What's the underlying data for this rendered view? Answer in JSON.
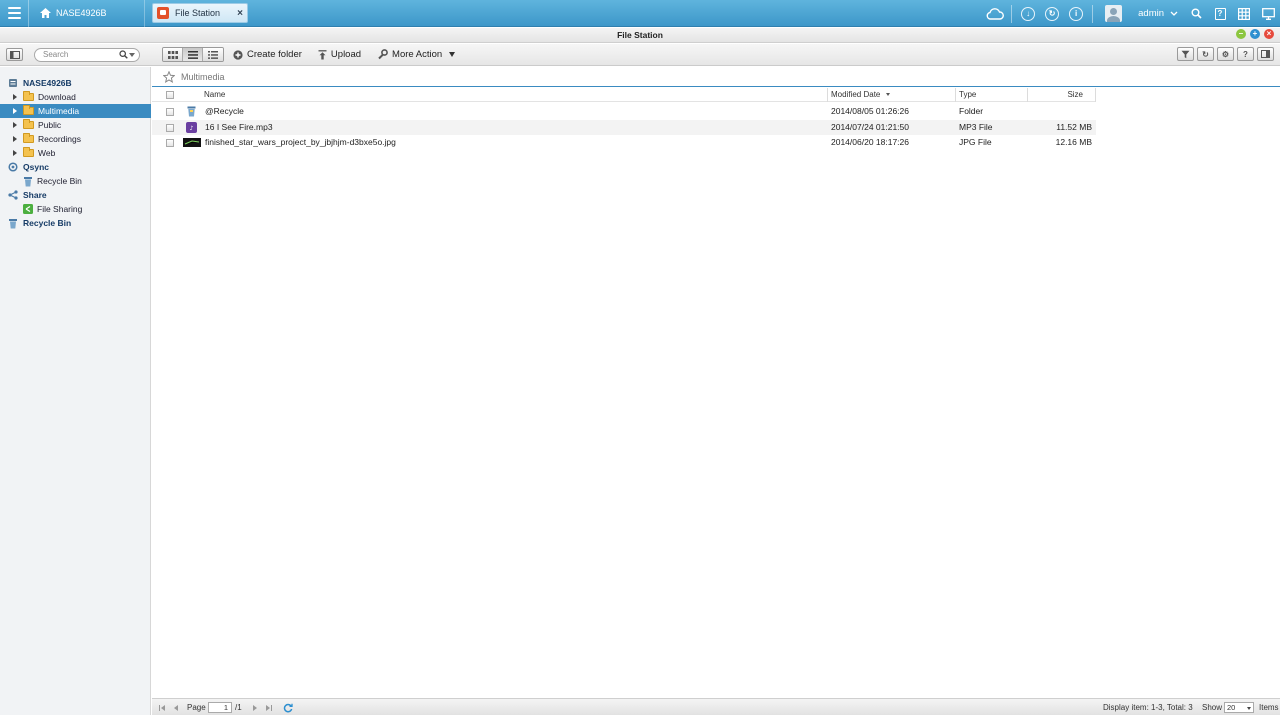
{
  "topbar": {
    "home_label": "NASE4926B",
    "app_tab_label": "File Station",
    "user": "admin"
  },
  "window": {
    "title": "File Station"
  },
  "toolbar": {
    "search_placeholder": "Search",
    "create_folder": "Create folder",
    "upload": "Upload",
    "more_action": "More Action"
  },
  "sidebar": {
    "items": [
      {
        "label": "NASE4926B",
        "kind": "root"
      },
      {
        "label": "Download",
        "kind": "folder"
      },
      {
        "label": "Multimedia",
        "kind": "folder",
        "selected": true
      },
      {
        "label": "Public",
        "kind": "folder"
      },
      {
        "label": "Recordings",
        "kind": "folder"
      },
      {
        "label": "Web",
        "kind": "folder"
      },
      {
        "label": "Qsync",
        "kind": "root"
      },
      {
        "label": "Recycle Bin",
        "kind": "leaf"
      },
      {
        "label": "Share",
        "kind": "root"
      },
      {
        "label": "File Sharing",
        "kind": "leaf"
      },
      {
        "label": "Recycle Bin",
        "kind": "root"
      }
    ]
  },
  "path": {
    "current": "Multimedia"
  },
  "table": {
    "columns": {
      "name": "Name",
      "modified": "Modified Date",
      "type": "Type",
      "size": "Size"
    },
    "rows": [
      {
        "name": "@Recycle",
        "modified": "2014/08/05 01:26:26",
        "type": "Folder",
        "size": "",
        "icon": "recycle-icon"
      },
      {
        "name": "16 I See Fire.mp3",
        "modified": "2014/07/24 01:21:50",
        "type": "MP3 File",
        "size": "11.52 MB",
        "icon": "audio-file-icon"
      },
      {
        "name": "finished_star_wars_project_by_jbjhjm-d3bxe5o.jpg",
        "modified": "2014/06/20 18:17:26",
        "type": "JPG File",
        "size": "12.16 MB",
        "icon": "image-thumbnail-icon"
      }
    ]
  },
  "status": {
    "page_label": "Page",
    "page_value": "1",
    "page_total": "/1",
    "display_text": "Display item: 1-3, Total: 3",
    "show_label": "Show",
    "show_value": "20",
    "items_label": "Items"
  },
  "colors": {
    "topbar": "#3d97c9",
    "selection": "#3a8bc1",
    "folder": "#f4c24f"
  }
}
